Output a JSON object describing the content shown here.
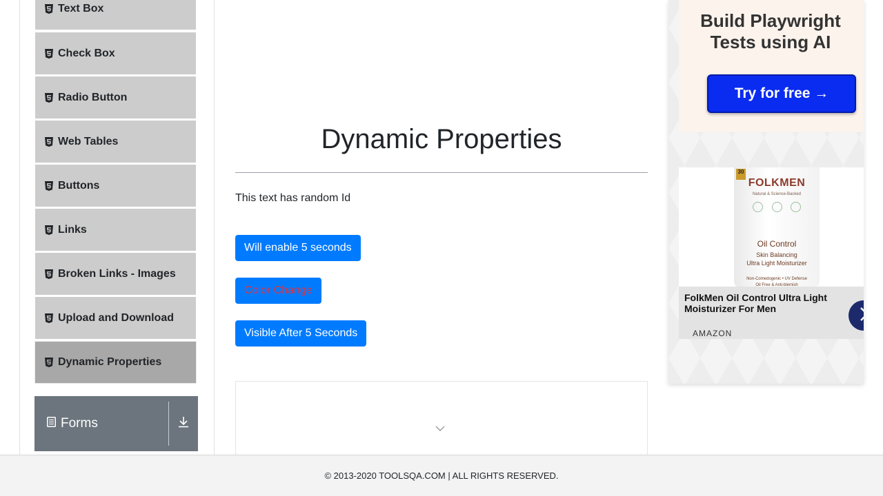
{
  "sidebar": {
    "items": [
      {
        "label": "Text Box"
      },
      {
        "label": "Check Box"
      },
      {
        "label": "Radio Button"
      },
      {
        "label": "Web Tables"
      },
      {
        "label": "Buttons"
      },
      {
        "label": "Links"
      },
      {
        "label": "Broken Links - Images"
      },
      {
        "label": "Upload and Download"
      },
      {
        "label": "Dynamic Properties"
      }
    ],
    "active_item": "Dynamic Properties",
    "groups": [
      {
        "label": "Forms",
        "icon": "document-icon"
      }
    ]
  },
  "main": {
    "title": "Dynamic Properties",
    "random_text": "This text has random Id",
    "buttons": {
      "enable_after": "Will enable 5 seconds",
      "color_change": "Color Change",
      "visible_after": "Visible After 5 Seconds"
    }
  },
  "ads": {
    "playwright": {
      "heading": "Build Playwright Tests using AI",
      "cta": "Try for free →"
    },
    "product": {
      "brand": "FOLKMEN",
      "badge": "30",
      "tagline": "Natural & Science-Backed",
      "product_name": "Oil Control",
      "line2": "Skin Balancing",
      "line3": "Ultra Light Moisturizer",
      "line4": "Non-Comedogenic • UV Defense",
      "line5": "Oil Free & Anti-blemish",
      "title": "FolkMen Oil Control Ultra Light Moisturizer For Men",
      "store": "AMAZON"
    }
  },
  "footer": {
    "text": "© 2013-2020 TOOLSQA.COM | ALL RIGHTS RESERVED."
  },
  "colors": {
    "primary": "#007bff",
    "danger_text": "#dc3545",
    "sidebar_bg": "#cccccc",
    "sidebar_active_bg": "#a8a8a8",
    "group_bg": "#6c757d",
    "cta_blue": "#0a2bf0"
  }
}
